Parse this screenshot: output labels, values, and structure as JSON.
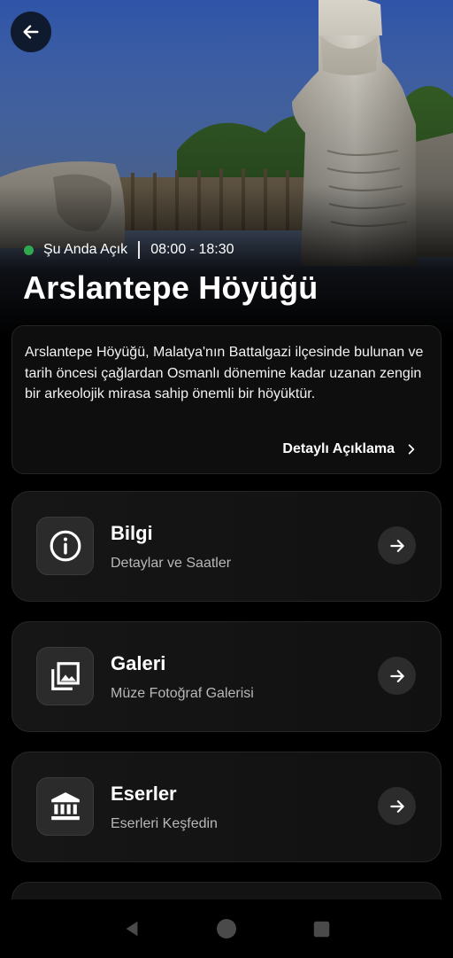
{
  "header": {
    "back_icon": "arrow-left-icon",
    "status_label": "Şu Anda Açık",
    "status_color": "#2fa84f",
    "hours": "08:00 - 18:30",
    "title": "Arslantepe Höyüğü"
  },
  "description": {
    "text": "Arslantepe Höyüğü, Malatya'nın Battalgazi ilçesinde bulunan ve tarih öncesi çağlardan Osmanlı dönemine kadar uzanan zengin bir arkeolojik mirasa sahip önemli bir höyüktür.",
    "link_label": "Detaylı Açıklama",
    "link_icon": "chevron-right-icon"
  },
  "menu": [
    {
      "title": "Bilgi",
      "subtitle": "Detaylar ve Saatler",
      "icon": "info-icon"
    },
    {
      "title": "Galeri",
      "subtitle": "Müze Fotoğraf Galerisi",
      "icon": "gallery-icon"
    },
    {
      "title": "Eserler",
      "subtitle": "Eserleri Keşfedin",
      "icon": "museum-icon"
    }
  ],
  "system_nav": [
    "back-triangle-icon",
    "home-circle-icon",
    "recents-square-icon"
  ]
}
